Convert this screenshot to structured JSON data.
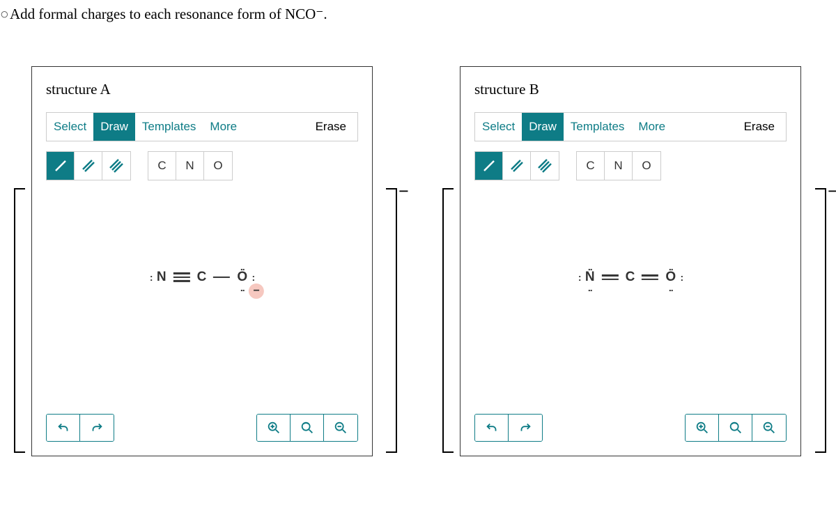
{
  "question": "Add formal charges to each resonance form of NCO⁻.",
  "panels": {
    "a": {
      "title": "structure A",
      "tabs": {
        "select": "Select",
        "draw": "Draw",
        "templates": "Templates",
        "more": "More"
      },
      "erase": "Erase",
      "elements": {
        "c": "C",
        "n": "N",
        "o": "O"
      },
      "molecule": {
        "n": "N",
        "c": "C",
        "o": "O",
        "n_lp_left": ":",
        "o_lp_right": ":",
        "o_lp_top": "..",
        "o_lp_bottom": "..",
        "charge": "−"
      }
    },
    "b": {
      "title": "structure B",
      "tabs": {
        "select": "Select",
        "draw": "Draw",
        "templates": "Templates",
        "more": "More"
      },
      "erase": "Erase",
      "elements": {
        "c": "C",
        "n": "N",
        "o": "O"
      },
      "molecule": {
        "n": "N",
        "c": "C",
        "o": "O",
        "n_lp_left": ":",
        "n_lp_top": "..",
        "n_lp_bottom": "..",
        "o_lp_right": ":",
        "o_lp_top": "..",
        "o_lp_bottom": ".."
      }
    }
  },
  "brackets": {
    "minus": "−"
  }
}
